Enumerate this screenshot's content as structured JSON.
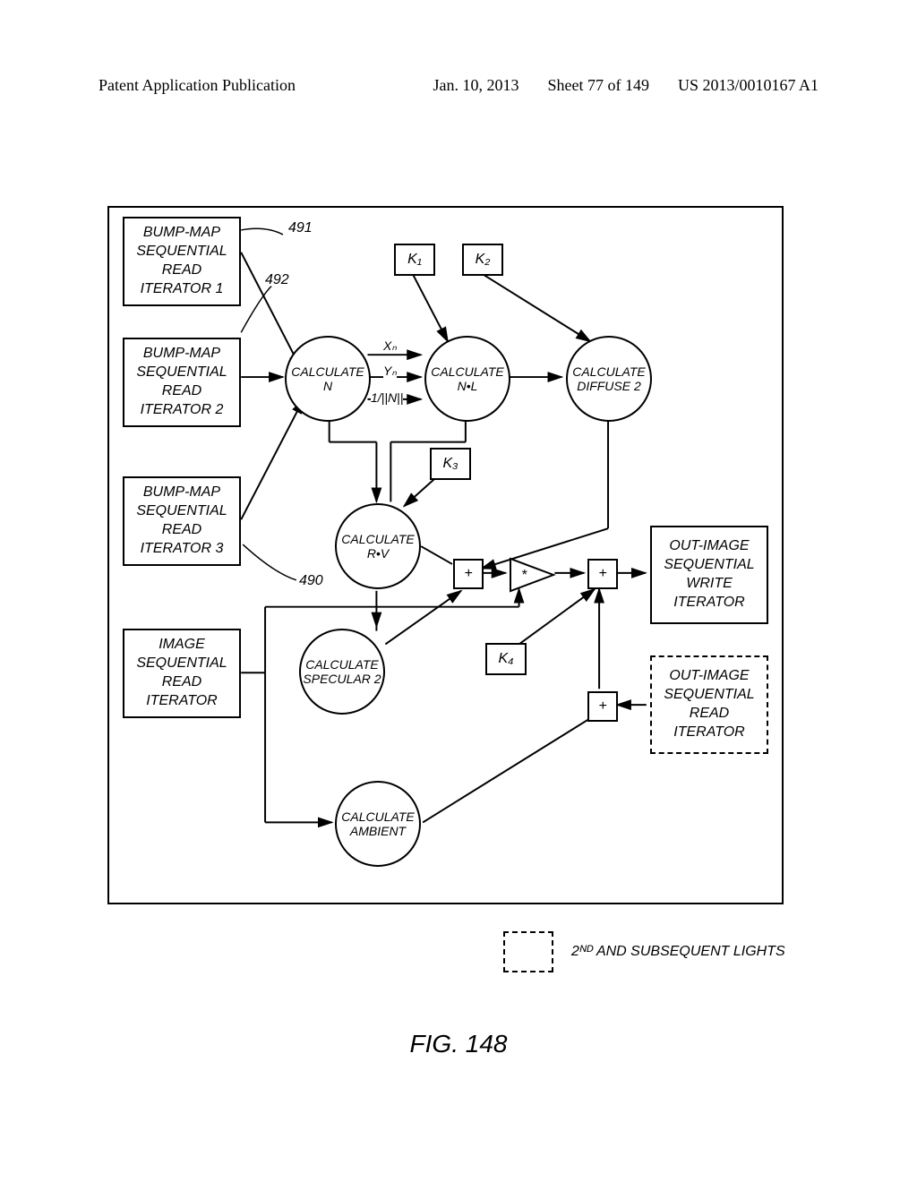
{
  "header": {
    "left": "Patent Application Publication",
    "date": "Jan. 10, 2013",
    "sheet": "Sheet 77 of 149",
    "pubno": "US 2013/0010167 A1"
  },
  "nodes": {
    "iter1": "BUMP-MAP SEQUENTIAL READ ITERATOR 1",
    "iter2": "BUMP-MAP SEQUENTIAL READ ITERATOR 2",
    "iter3": "BUMP-MAP SEQUENTIAL READ ITERATOR 3",
    "imgiter": "IMAGE SEQUENTIAL READ ITERATOR",
    "outwrite": "OUT-IMAGE SEQUENTIAL WRITE ITERATOR",
    "outread": "OUT-IMAGE SEQUENTIAL READ ITERATOR",
    "calcN": "CALCULATE N",
    "calcNL": "CALCULATE N•L",
    "calcDiff": "CALCULATE DIFFUSE 2",
    "calcRV": "CALCULATE R•V",
    "calcSpec": "CALCULATE SPECULAR 2",
    "calcAmb": "CALCULATE AMBIENT",
    "k1": "K₁",
    "k2": "K₂",
    "k3": "K₃",
    "k4": "K₄",
    "plus1": "+",
    "plus2": "+",
    "plus3": "+",
    "mult": "*"
  },
  "edgeLabels": {
    "xn": "Xₙ",
    "yn": "Yₙ",
    "oneOverN": "1/||N||"
  },
  "refs": {
    "r490": "490",
    "r491": "491",
    "r492": "492"
  },
  "legend": "2ᴺᴰ AND SUBSEQUENT LIGHTS",
  "caption": "FIG. 148"
}
